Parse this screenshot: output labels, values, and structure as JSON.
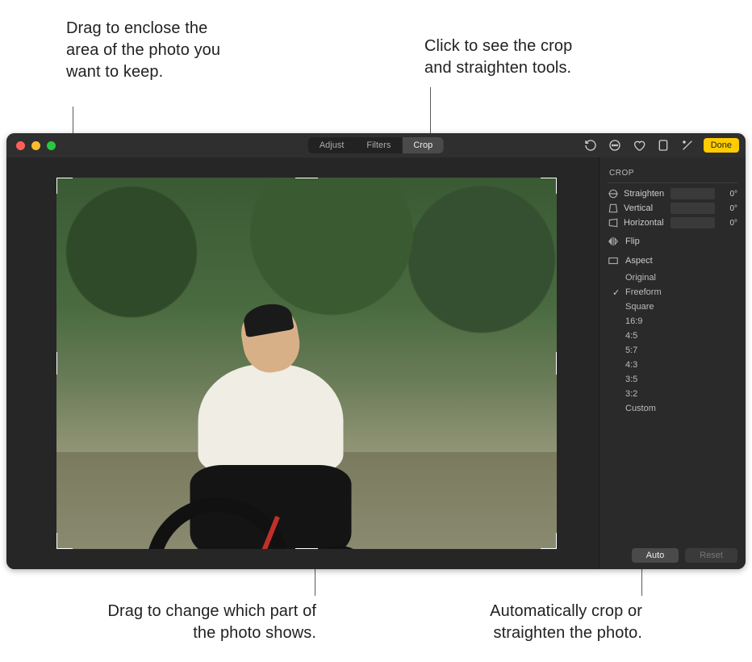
{
  "callouts": {
    "top_left": "Drag to enclose the area of the photo you want to keep.",
    "top_right": "Click to see the crop and straighten tools.",
    "bottom_left": "Drag to change which part of the photo shows.",
    "bottom_right": "Automatically crop or straighten the photo."
  },
  "tabs": {
    "adjust": "Adjust",
    "filters": "Filters",
    "crop": "Crop"
  },
  "toolbar": {
    "done": "Done"
  },
  "sidebar": {
    "title": "CROP",
    "straighten": {
      "label": "Straighten",
      "value": "0°"
    },
    "vertical": {
      "label": "Vertical",
      "value": "0°"
    },
    "horizontal": {
      "label": "Horizontal",
      "value": "0°"
    },
    "flip": "Flip",
    "aspect": "Aspect",
    "aspects": {
      "original": "Original",
      "freeform": "Freeform",
      "square": "Square",
      "r16_9": "16:9",
      "r4_5": "4:5",
      "r5_7": "5:7",
      "r4_3": "4:3",
      "r3_5": "3:5",
      "r3_2": "3:2",
      "custom": "Custom"
    },
    "auto": "Auto",
    "reset": "Reset"
  }
}
